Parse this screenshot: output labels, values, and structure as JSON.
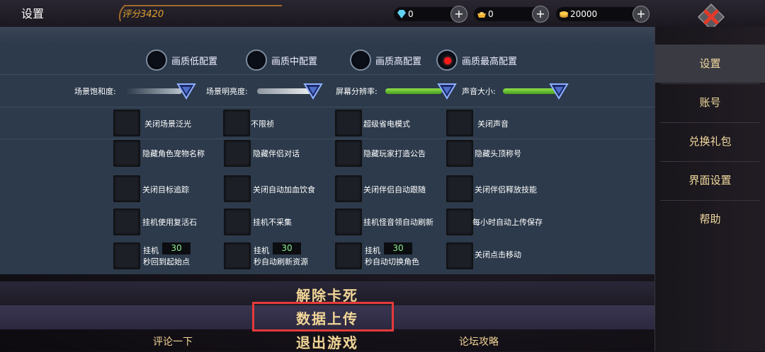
{
  "header": {
    "title": "设置",
    "score": "评分3420",
    "currencies": [
      {
        "icon": "diamond-icon",
        "value": "0"
      },
      {
        "icon": "gold-ingot-icon",
        "value": "0"
      },
      {
        "icon": "coin-icon",
        "value": "20000"
      }
    ]
  },
  "quality": {
    "options": [
      "画质低配置",
      "画质中配置",
      "画质高配置",
      "画质最高配置"
    ],
    "selected": "画质最高配置"
  },
  "sliders": [
    {
      "label": "场景饱和度:",
      "level": 0.8,
      "color": "grey"
    },
    {
      "label": "场景明亮度:",
      "level": 0.8,
      "color": "grey"
    },
    {
      "label": "屏幕分辨率:",
      "level": 0.9,
      "color": "green"
    },
    {
      "label": "声音大小:",
      "level": 0.9,
      "color": "green"
    }
  ],
  "options": [
    [
      "关闭场景泛光",
      "不限祯",
      "超级省电模式",
      "关闭声音"
    ],
    [
      "隐藏角色宠物名称",
      "隐藏伴侣对话",
      "隐藏玩家打造公告",
      "隐藏头顶称号"
    ],
    [
      "关闭目标追踪",
      "关闭自动加血饮食",
      "关闭伴侣自动跟随",
      "关闭伴侣释放技能"
    ],
    [
      "挂机使用复活石",
      "挂机不采集",
      "挂机怪音领自动刷新",
      "每小时自动上传保存"
    ]
  ],
  "timed_options": [
    {
      "prefix": "挂机",
      "value": "30",
      "suffix": "秒回到起始点"
    },
    {
      "prefix": "挂机",
      "value": "30",
      "suffix": "秒自动刷新资源"
    },
    {
      "prefix": "挂机",
      "value": "30",
      "suffix": "秒自动切换角色"
    },
    {
      "label": "关闭点击移动"
    }
  ],
  "side_menu": [
    "设置",
    "账号",
    "兑换礼包",
    "界面设置",
    "帮助"
  ],
  "side_active": "设置",
  "bottom": {
    "unstuck": "解除卡死",
    "upload": "数据上传",
    "exit": "退出游戏",
    "comment": "评论一下",
    "forum": "论坛攻略"
  },
  "colors": {
    "accent_text": "#f1d596",
    "selected_dot": "#ff1a1a",
    "highlight_box": "#e53a3a"
  }
}
